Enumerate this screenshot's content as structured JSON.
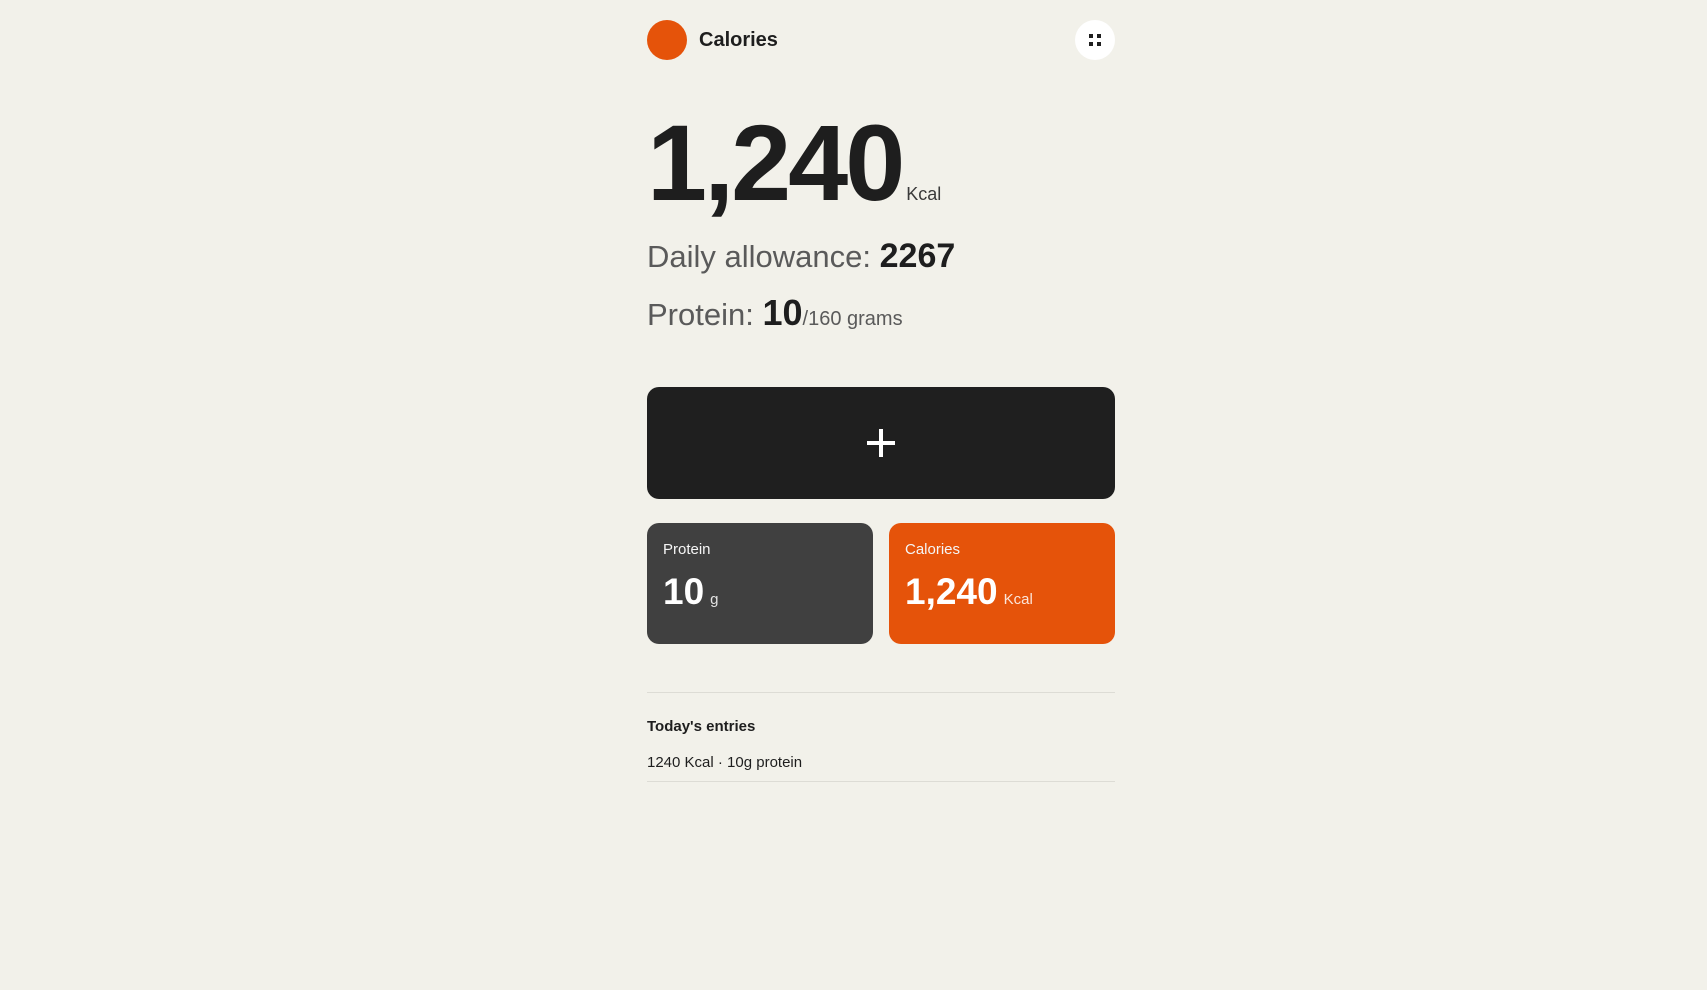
{
  "header": {
    "title": "Calories",
    "logo_color": "#e5530a",
    "menu_icon": "grid-dots-icon"
  },
  "summary": {
    "total": "1,240",
    "total_unit": "Kcal",
    "allowance_label": "Daily allowance:",
    "allowance_value": "2267",
    "protein_label": "Protein:",
    "protein_value": "10",
    "protein_goal": "/160 grams"
  },
  "add_button": {
    "icon": "plus-icon"
  },
  "cards": {
    "protein": {
      "label": "Protein",
      "value": "10",
      "unit": "g",
      "color": "#404040"
    },
    "calories": {
      "label": "Calories",
      "value": "1,240",
      "unit": "Kcal",
      "color": "#e5530a"
    }
  },
  "entries": {
    "heading": "Today's entries",
    "items": [
      {
        "text": "1240 Kcal · 10g protein"
      }
    ]
  }
}
